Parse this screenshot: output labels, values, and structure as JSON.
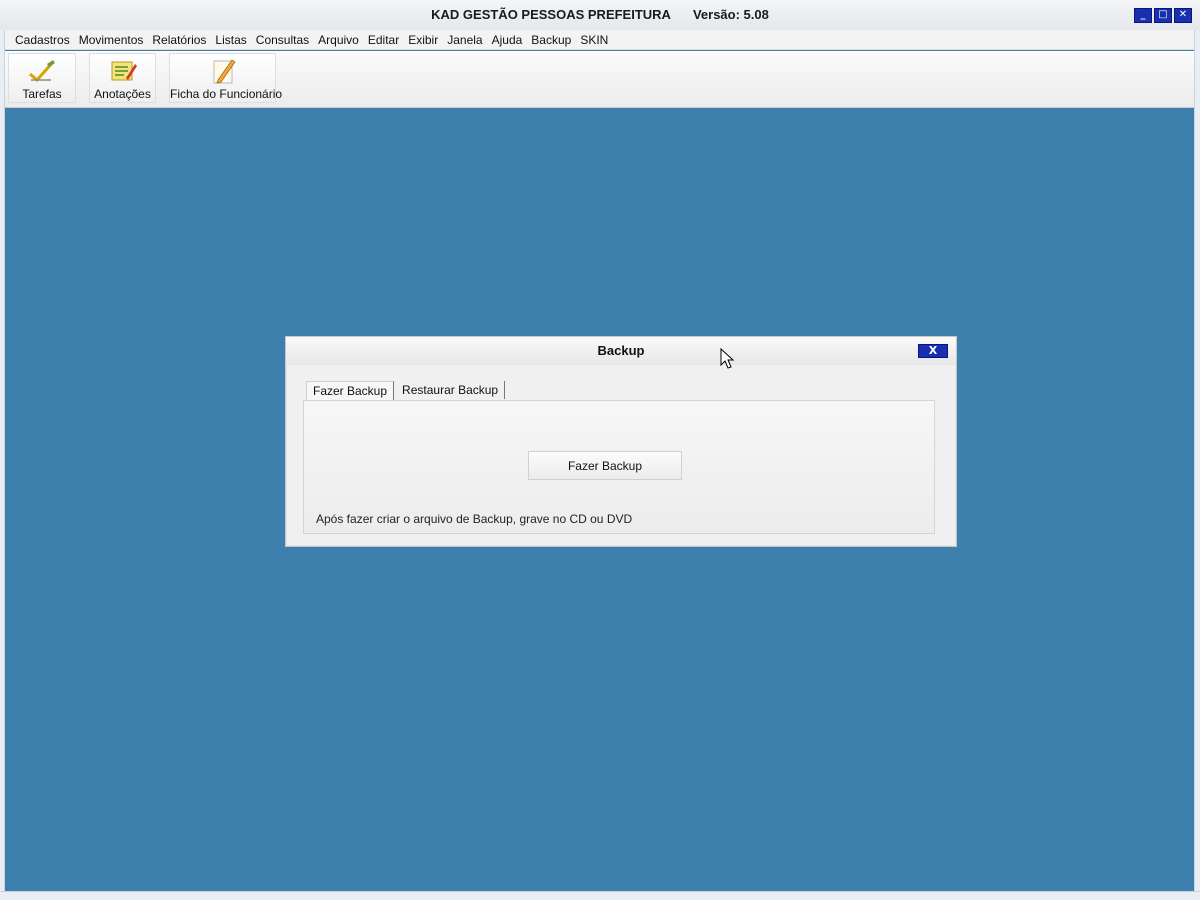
{
  "window": {
    "title": "KAD GESTÃO PESSOAS PREFEITURA",
    "version": "Versão: 5.08",
    "controls": {
      "minimize": "_",
      "maximize": "□",
      "close": "✕"
    }
  },
  "menubar": {
    "items": [
      {
        "label": "Cadastros"
      },
      {
        "label": "Movimentos"
      },
      {
        "label": "Relatórios"
      },
      {
        "label": "Listas"
      },
      {
        "label": "Consultas"
      },
      {
        "label": "Arquivo"
      },
      {
        "label": "Editar"
      },
      {
        "label": "Exibir"
      },
      {
        "label": "Janela"
      },
      {
        "label": "Ajuda"
      },
      {
        "label": "Backup"
      },
      {
        "label": "SKIN"
      }
    ]
  },
  "toolbar": {
    "items": [
      {
        "label": "Tarefas",
        "icon": "checkmark-pencil-icon"
      },
      {
        "label": "Anotações",
        "icon": "notes-icon"
      },
      {
        "label": "Ficha do Funcionário",
        "icon": "pencil-sheet-icon"
      }
    ]
  },
  "dialog": {
    "title": "Backup",
    "close_label": "X",
    "tabs": [
      {
        "label": "Fazer Backup",
        "active": true
      },
      {
        "label": "Restaurar Backup",
        "active": false
      }
    ],
    "button_label": "Fazer Backup",
    "hint": "Após fazer criar o arquivo de Backup, grave no CD ou DVD"
  },
  "colors": {
    "desktop": "#3d80ad",
    "window_controls": "#1a2fb0"
  }
}
